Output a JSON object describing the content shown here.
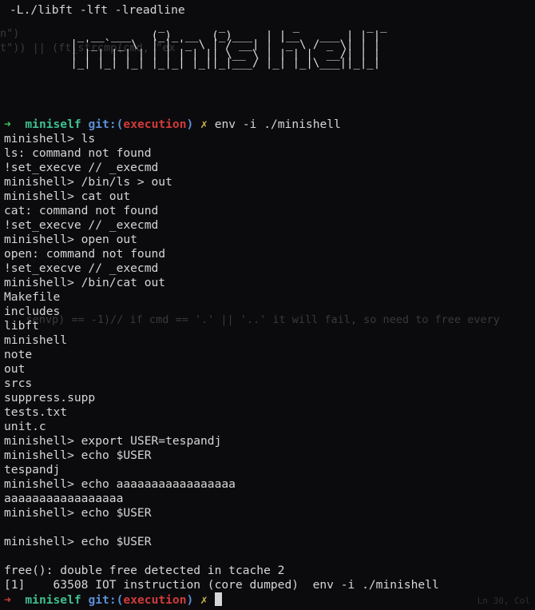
{
  "link_line": "-L./libft -lft -lreadline",
  "ghost": {
    "top_1": "n\")",
    "top_2": "t\")) || (ft_strcmp(cmd, \"ex",
    "mid": "    senvp) == -1)// if cmd == '.' || '..' it will fail, so need to free every",
    "corner": "Ln 30, Col"
  },
  "banner_art": "              _        _          _          _ _\n  _ __ ___   (_)_ __  (_)___  | |__   ___ | | |\n | '_ ` _ \\  | | '_ \\ | / __| | '_ \\ / _ \\| | |\n | | | | | | | | | | || \\__ \\ | | | |  __/| | |\n |_| |_| |_| |_|_| |_||_|___/ |_| |_|\\___||_|_|",
  "prompt_1": {
    "arrow": "➜",
    "dir": "miniself",
    "git_label": "git:",
    "branch_open": "(",
    "branch": "execution",
    "branch_close": ")",
    "dirty": "✗",
    "command": "env -i ./minishell"
  },
  "output_lines": [
    "minishell> ls",
    "ls: command not found",
    "!set_execve // _execmd",
    "minishell> /bin/ls > out",
    "minishell> cat out",
    "cat: command not found",
    "!set_execve // _execmd",
    "minishell> open out",
    "open: command not found",
    "!set_execve // _execmd",
    "minishell> /bin/cat out",
    "Makefile",
    "includes",
    "libft",
    "minishell",
    "note",
    "out",
    "srcs",
    "suppress.supp",
    "tests.txt",
    "unit.c",
    "minishell> export USER=tespandj",
    "minishell> echo $USER",
    "tespandj",
    "minishell> echo aaaaaaaaaaaaaaaaa",
    "aaaaaaaaaaaaaaaaa",
    "minishell> echo $USER",
    "",
    "minishell> echo $USER",
    "",
    "free(): double free detected in tcache 2",
    "[1]    63508 IOT instruction (core dumped)  env -i ./minishell"
  ],
  "prompt_2": {
    "arrow": "➜",
    "dir": "miniself",
    "git_label": "git:",
    "branch_open": "(",
    "branch": "execution",
    "branch_close": ")",
    "dirty": "✗"
  }
}
